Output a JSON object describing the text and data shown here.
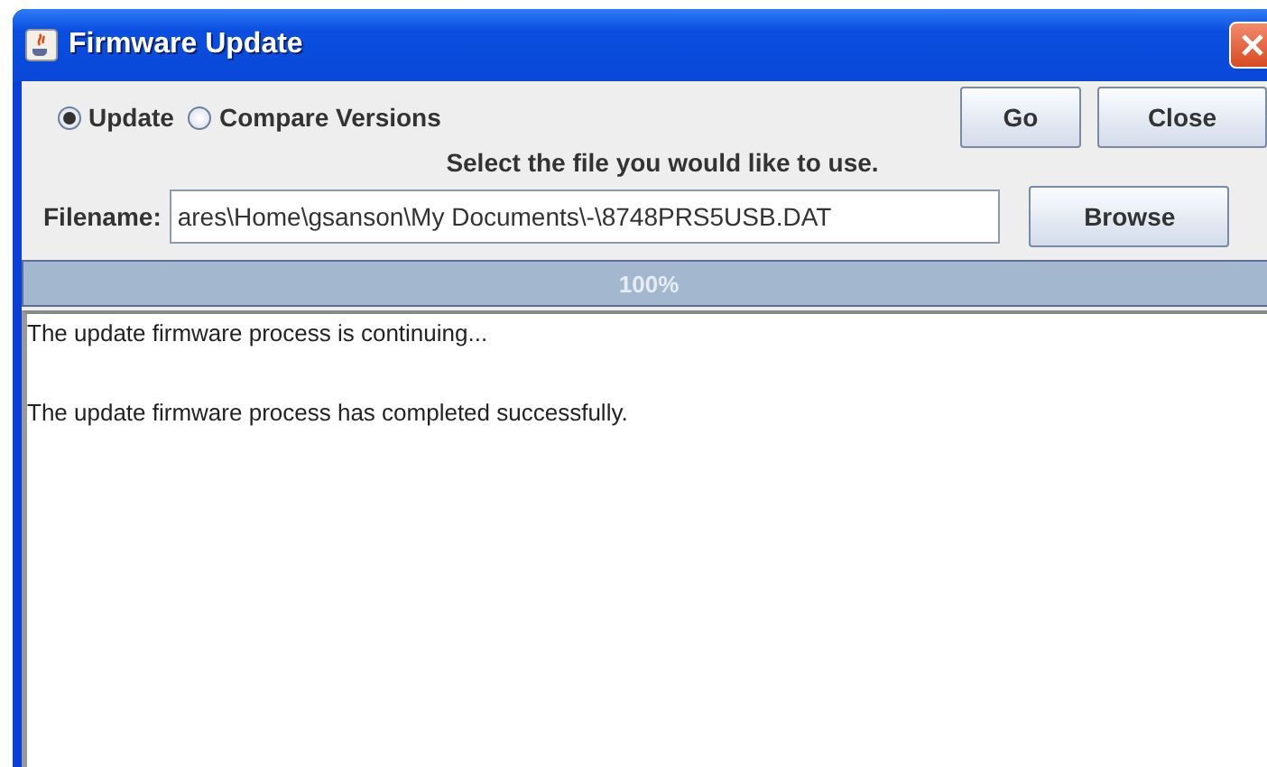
{
  "window": {
    "title": "Firmware Update"
  },
  "modes": [
    {
      "label": "Update",
      "selected": true
    },
    {
      "label": "Compare Versions",
      "selected": false
    }
  ],
  "buttons": [
    "Go",
    "Close"
  ],
  "instruction": "Select the file you would like to use.",
  "file": {
    "label": "Filename:",
    "value": "ares\\Home\\gsanson\\My Documents\\-\\8748PRS5USB.DAT",
    "button": "Browse"
  },
  "progress": {
    "level": 1,
    "reading": "100%"
  },
  "log": [
    "The update firmware process is continuing...",
    "The update firmware process has completed successfully."
  ]
}
